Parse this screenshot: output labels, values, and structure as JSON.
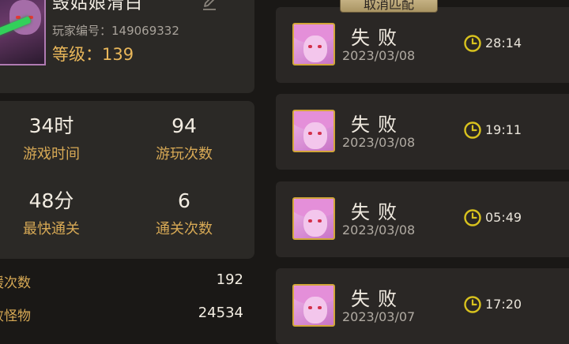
{
  "profile": {
    "name": "毁姑娘清白",
    "player_id": "玩家编号：149069332",
    "level": "等级：139"
  },
  "stats": [
    {
      "value": "34时",
      "label": "游戏时间"
    },
    {
      "value": "94",
      "label": "游玩次数"
    },
    {
      "value": "48分",
      "label": "最快通关"
    },
    {
      "value": "6",
      "label": "通关次数"
    }
  ],
  "details": [
    {
      "label": "援次数",
      "value": "192"
    },
    {
      "label": "败怪物",
      "value": "24534"
    }
  ],
  "match_button": "取消匹配",
  "records": [
    {
      "result": "失败",
      "date": "2023/03/08",
      "duration": "28:14"
    },
    {
      "result": "失败",
      "date": "2023/03/08",
      "duration": "19:11"
    },
    {
      "result": "失败",
      "date": "2023/03/08",
      "duration": "05:49"
    },
    {
      "result": "失败",
      "date": "2023/03/07",
      "duration": "17:20"
    }
  ],
  "colors": {
    "accent_gold": "#d7a955",
    "level_gold": "#e9b75a",
    "clock_yellow": "#d8c21e",
    "panel": "#2b2926"
  },
  "icons": {
    "edit": "edit-icon",
    "clock": "clock-icon"
  }
}
